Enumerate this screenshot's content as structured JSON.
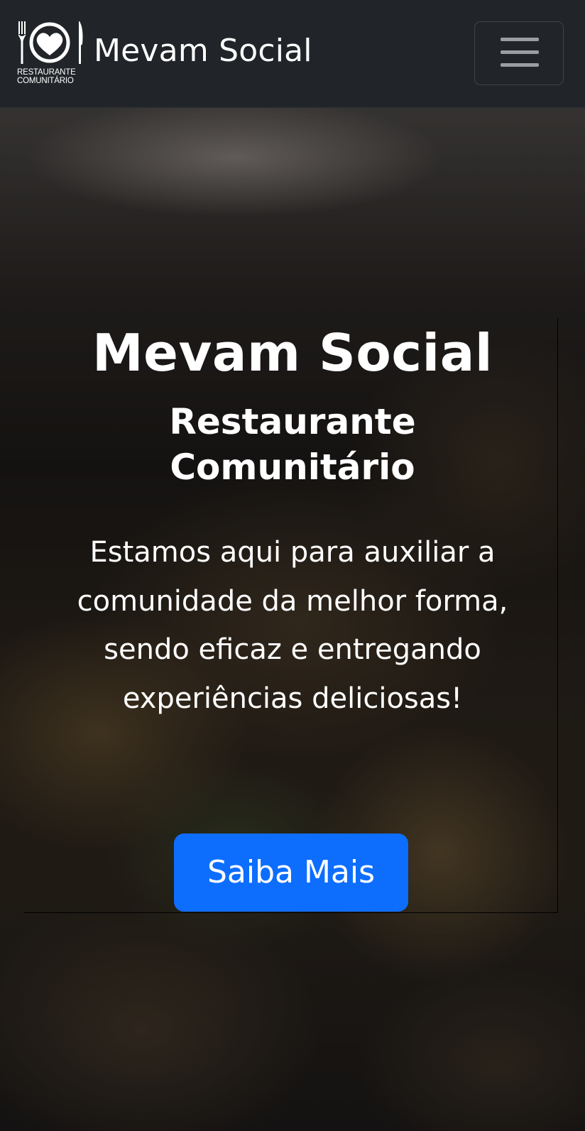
{
  "navbar": {
    "logo_line1": "RESTAURANTE",
    "logo_line2": "COMUNITÁRIO",
    "brand_name": "Mevam Social",
    "toggler_icon": "hamburger-menu-icon"
  },
  "hero": {
    "title": "Mevam Social",
    "subtitle_line1": "Restaurante",
    "subtitle_line2": "Comunitário",
    "description": "Estamos aqui para auxiliar a comunidade da melhor forma, sendo eficaz e entregando experiências deliciosas!",
    "cta_label": "Saiba Mais"
  },
  "colors": {
    "navbar_bg": "#212529",
    "cta_bg": "#0d6efd",
    "text": "#ffffff"
  }
}
